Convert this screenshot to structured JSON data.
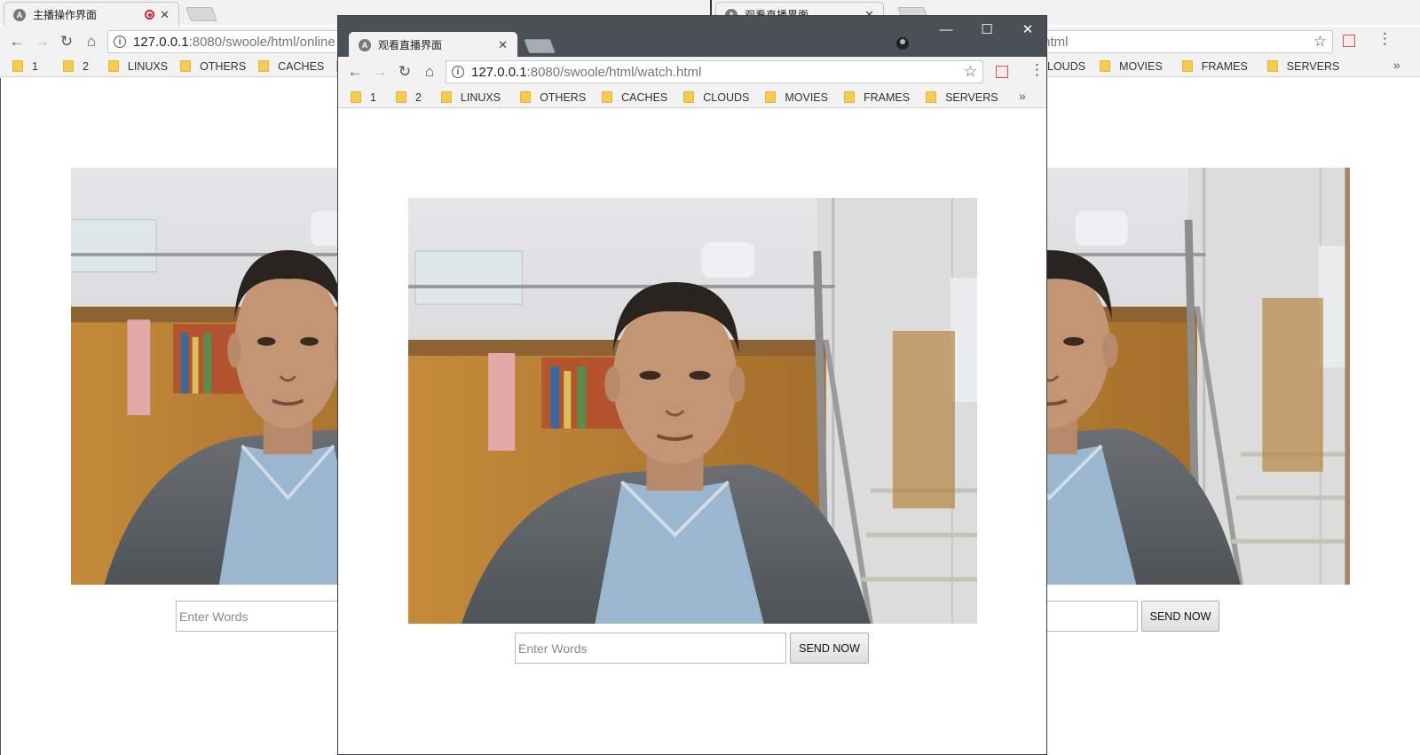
{
  "left_window": {
    "tab": {
      "favicon_letter": "A",
      "title": "主播操作界面"
    },
    "url": {
      "host": "127.0.0.1",
      "path": ":8080/swoole/html/online"
    },
    "bookmarks": [
      "1",
      "2",
      "LINUXS",
      "OTHERS",
      "CACHES",
      "C"
    ],
    "chat": {
      "placeholder": "Enter Words"
    }
  },
  "right_window": {
    "tab": {
      "favicon_letter": "A",
      "title": "观看直播界面"
    },
    "url": {
      "path": ".html"
    },
    "bookmarks": [
      "LOUDS",
      "MOVIES",
      "FRAMES",
      "SERVERS"
    ],
    "chat": {
      "send_label": "SEND NOW"
    }
  },
  "front_window": {
    "tab": {
      "favicon_letter": "A",
      "title": "观看直播界面"
    },
    "url": {
      "host": "127.0.0.1",
      "path": ":8080/swoole/html/watch.html"
    },
    "bookmarks": [
      "1",
      "2",
      "LINUXS",
      "OTHERS",
      "CACHES",
      "CLOUDS",
      "MOVIES",
      "FRAMES",
      "SERVERS"
    ],
    "chat": {
      "placeholder": "Enter Words",
      "send_label": "SEND NOW"
    }
  },
  "icons": {
    "back": "back-arrow-icon",
    "forward": "forward-arrow-icon",
    "reload": "reload-icon",
    "home": "home-icon",
    "info": "site-info-icon",
    "star": "bookmark-star-icon",
    "menu": "kebab-menu-icon",
    "minimize": "minimize-icon",
    "maximize": "maximize-icon",
    "close": "close-icon",
    "folder": "bookmark-folder-icon",
    "profile": "profile-icon",
    "extension": "extension-icon"
  },
  "colors": {
    "dark_frame": "#4b5057",
    "toolbar": "#f2f2f2",
    "folder": "#f7cb4d",
    "record": "#dd2233"
  }
}
